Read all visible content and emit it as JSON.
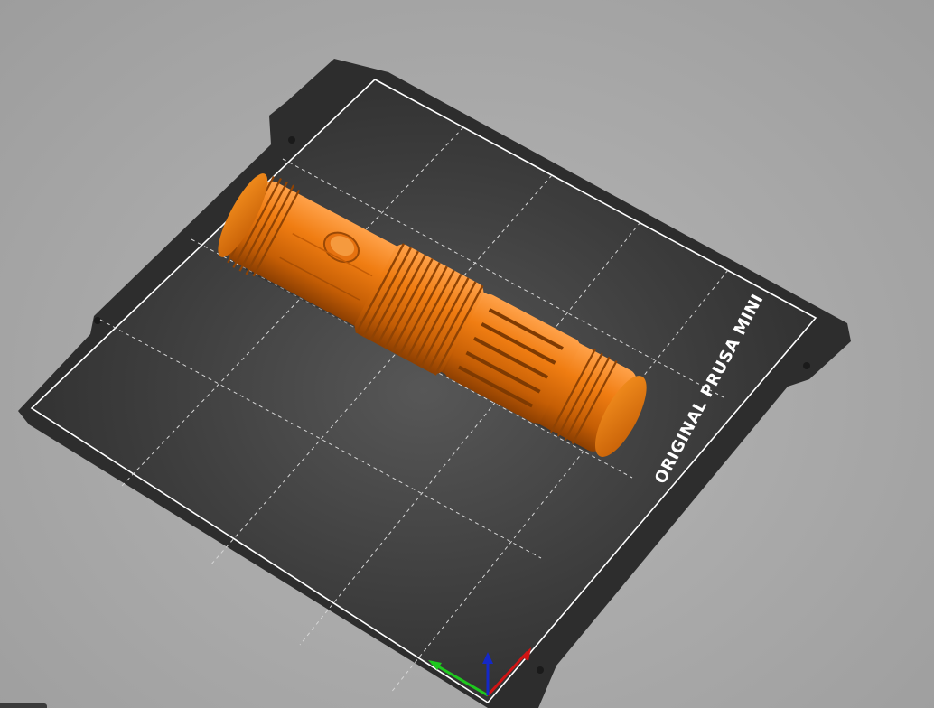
{
  "scene": {
    "bed_label": "ORIGINAL PRUSA MINI",
    "colors": {
      "background": "#a9a9a9",
      "bed_sheet": "#2e2e2e",
      "bed_border": "#ffffff",
      "grid": "#cfcfcf",
      "model": "#e8760a",
      "axis_x": "#d01414",
      "axis_y": "#1ec81e",
      "axis_z": "#1428c8"
    },
    "icons": {
      "x_axis": "axis-x-arrow-icon",
      "y_axis": "axis-y-arrow-icon",
      "z_axis": "axis-z-arrow-icon"
    }
  }
}
